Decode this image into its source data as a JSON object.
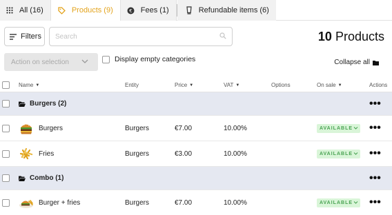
{
  "tabs": [
    {
      "label": "All (16)",
      "icon": "grid-icon"
    },
    {
      "label": "Products (9)",
      "icon": "tag-icon"
    },
    {
      "label": "Fees (1)",
      "icon": "fee-icon"
    },
    {
      "label": "Refundable items (6)",
      "icon": "glass-icon"
    }
  ],
  "toolbar": {
    "filters_label": "Filters",
    "search_placeholder": "Search",
    "count_number": "10",
    "count_label": "Products",
    "action_label": "Action on selection",
    "empty_categories_label": "Display empty categories",
    "collapse_label": "Collapse all"
  },
  "table": {
    "headers": {
      "name": "Name",
      "entity": "Entity",
      "price": "Price",
      "vat": "VAT",
      "options": "Options",
      "on_sale": "On sale",
      "actions": "Actions"
    },
    "categories": [
      {
        "label": "Burgers (2)"
      },
      {
        "label": "Combo (1)"
      }
    ],
    "items": [
      {
        "name": "Burgers",
        "entity": "Burgers",
        "price": "€7.00",
        "vat": "10.00%",
        "status": "AVAILABLE"
      },
      {
        "name": "Fries",
        "entity": "Burgers",
        "price": "€3.00",
        "vat": "10.00%",
        "status": "AVAILABLE"
      },
      {
        "name": "Burger + fries",
        "entity": "Burgers",
        "price": "€7.00",
        "vat": "10.00%",
        "status": "AVAILABLE"
      }
    ],
    "more_label": "•••"
  },
  "colors": {
    "accent": "#e3a31c",
    "category_bg": "#e5e8f1",
    "badge_bg": "#d9f5d8",
    "badge_text": "#49a352"
  }
}
